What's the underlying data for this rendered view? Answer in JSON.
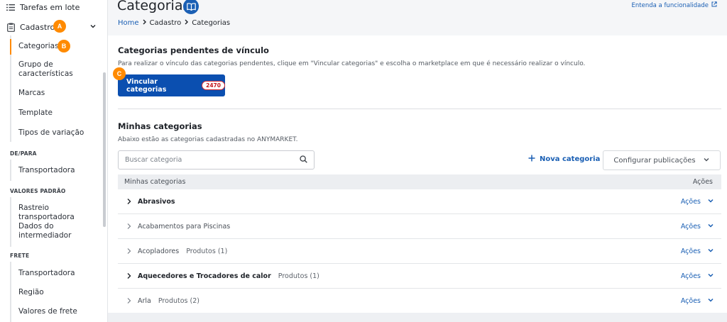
{
  "sidebar": {
    "top_items": [
      {
        "label": "Tarefas em lote",
        "icon": "list-icon"
      },
      {
        "label": "Cadastro",
        "icon": "clipboard-icon"
      }
    ],
    "cadastro_items": [
      "Categorias",
      "Grupo de características",
      "Marcas",
      "Template",
      "Tipos de variação"
    ],
    "sections": [
      {
        "title": "DE/PARA",
        "items": [
          "Transportadora"
        ]
      },
      {
        "title": "VALORES PADRÃO",
        "items": [
          "Rastreio transportadora",
          "Dados do intermediador"
        ]
      },
      {
        "title": "FRETE",
        "items": [
          "Transportadora",
          "Região",
          "Valores de frete"
        ]
      }
    ]
  },
  "badges": {
    "a": "A",
    "b": "B",
    "c": "C"
  },
  "header": {
    "title": "Categorias",
    "help_link": "Entenda a funcionalidade",
    "breadcrumb": [
      "Home",
      "Cadastro",
      "Categorias"
    ]
  },
  "pending": {
    "title": "Categorias pendentes de vínculo",
    "description": "Para realizar o vínculo das categorias pendentes, clique em \"Vincular categorias\" e escolha o marketplace em que é necessário realizar o vínculo.",
    "button_label": "Vincular categorias",
    "count": "2470"
  },
  "mine": {
    "title": "Minhas categorias",
    "description": "Abaixo estão as categorias cadastradas no ANYMARKET.",
    "search_placeholder": "Buscar categoria",
    "new_category": "Nova categoria",
    "config_publications": "Configurar publicações",
    "table_header": {
      "name": "Minhas categorias",
      "actions": "Ações"
    },
    "rows": [
      {
        "name": "Abrasivos",
        "products": "",
        "bold": true,
        "actions": "Ações"
      },
      {
        "name": "Acabamentos para Piscinas",
        "products": "",
        "bold": false,
        "actions": "Ações"
      },
      {
        "name": "Acopladores",
        "products": "Produtos (1)",
        "bold": false,
        "actions": "Ações"
      },
      {
        "name": "Aquecedores e Trocadores de calor",
        "products": "Produtos (1)",
        "bold": true,
        "actions": "Ações"
      },
      {
        "name": "Arla",
        "products": "Produtos (2)",
        "bold": false,
        "actions": "Ações"
      }
    ]
  },
  "colors": {
    "accent": "#1a5fb4",
    "button": "#0b4fb0",
    "badge": "#ff8a00",
    "count_border": "#d62b33"
  }
}
